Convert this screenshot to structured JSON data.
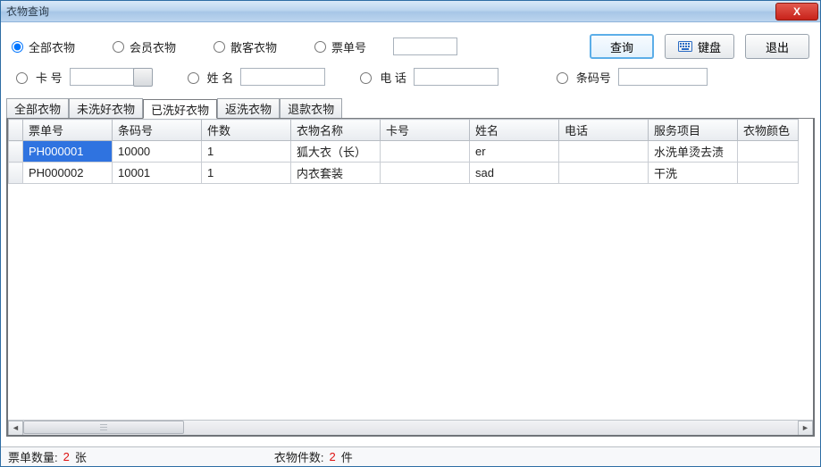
{
  "window": {
    "title": "衣物查询"
  },
  "filter": {
    "radios": {
      "all": "全部衣物",
      "member": "会员衣物",
      "guest": "散客衣物",
      "ticket": "票单号",
      "selected": "all"
    },
    "ticket_value": "",
    "row2": {
      "card_label": "卡   号",
      "card_value": "",
      "name_label": "姓   名",
      "name_value": "",
      "phone_label": "电   话",
      "phone_value": "",
      "barcode_label": "条码号",
      "barcode_value": ""
    }
  },
  "buttons": {
    "query": "查询",
    "keyboard": "键盘",
    "exit": "退出",
    "close": "X"
  },
  "tabs": {
    "items": [
      "全部衣物",
      "未洗好衣物",
      "已洗好衣物",
      "返洗衣物",
      "退款衣物"
    ],
    "active_index": 2
  },
  "table": {
    "columns": [
      "票单号",
      "条码号",
      "件数",
      "衣物名称",
      "卡号",
      "姓名",
      "电话",
      "服务项目",
      "衣物颜色"
    ],
    "widths": [
      100,
      100,
      100,
      100,
      100,
      100,
      100,
      100,
      68
    ],
    "rows": [
      {
        "票单号": "PH000001",
        "条码号": "10000",
        "件数": "1",
        "衣物名称": "狐大衣（长）",
        "卡号": "",
        "姓名": "er",
        "电话": "",
        "服务项目": "水洗单烫去渍",
        "衣物颜色": "",
        "selected": true
      },
      {
        "票单号": "PH000002",
        "条码号": "10001",
        "件数": "1",
        "衣物名称": "内衣套装",
        "卡号": "",
        "姓名": "sad",
        "电话": "",
        "服务项目": "干洗",
        "衣物颜色": "",
        "selected": false
      }
    ]
  },
  "status": {
    "ticket_count_label": "票单数量:",
    "ticket_count_value": "2",
    "ticket_count_unit": "张",
    "item_count_label": "衣物件数:",
    "item_count_value": "2",
    "item_count_unit": "件"
  }
}
